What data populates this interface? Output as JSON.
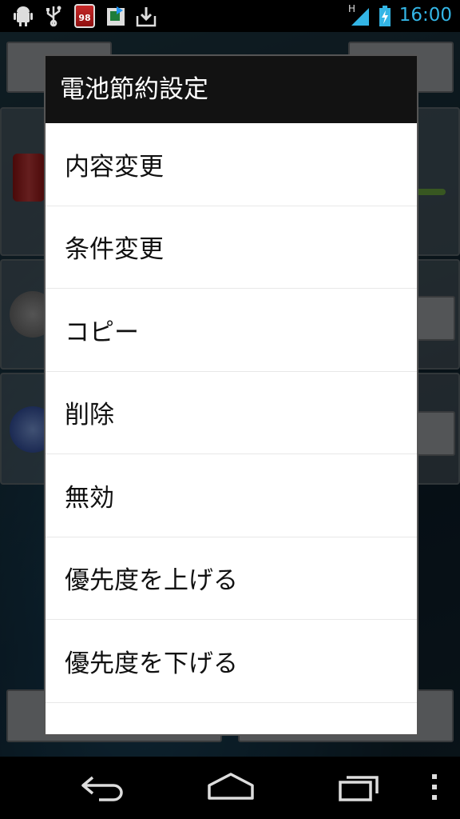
{
  "status_bar": {
    "notification_icons": [
      "android-debug-icon",
      "usb-icon",
      "battery-app-icon",
      "sync-icon",
      "download-icon"
    ],
    "battery_app_badge": "98",
    "network_type": "H",
    "clock": "16:00",
    "accent_color": "#33b5e5"
  },
  "dialog": {
    "title": "電池節約設定",
    "items": [
      {
        "label": "内容変更"
      },
      {
        "label": "条件変更"
      },
      {
        "label": "コピー"
      },
      {
        "label": "削除"
      },
      {
        "label": "無効"
      },
      {
        "label": "優先度を上げる"
      },
      {
        "label": "優先度を下げる"
      }
    ]
  },
  "nav_bar": {
    "buttons": [
      "back-icon",
      "home-icon",
      "recent-apps-icon",
      "menu-icon"
    ]
  }
}
